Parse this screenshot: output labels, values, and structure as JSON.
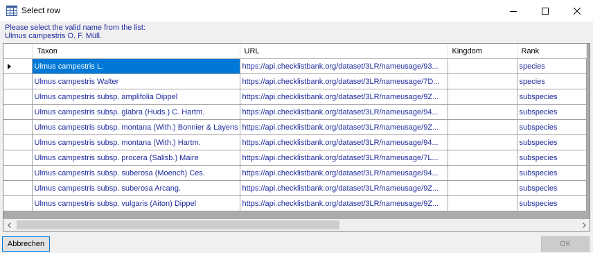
{
  "window": {
    "title": "Select row",
    "icon": "table-grid-icon"
  },
  "prompt": {
    "line1": "Please select the valid name from the list:",
    "line2": "Ulmus campestris O. F. Müll."
  },
  "grid": {
    "columns": [
      "Taxon",
      "URL",
      "Kingdom",
      "Rank"
    ],
    "rows": [
      {
        "taxon": "Ulmus campestris L.",
        "url": "https://api.checklistbank.org/dataset/3LR/nameusage/93...",
        "kingdom": "",
        "rank": "species"
      },
      {
        "taxon": "Ulmus campestris Walter",
        "url": "https://api.checklistbank.org/dataset/3LR/nameusage/7D...",
        "kingdom": "",
        "rank": "species"
      },
      {
        "taxon": "Ulmus campestris subsp. amplifolia Dippel",
        "url": "https://api.checklistbank.org/dataset/3LR/nameusage/9Z...",
        "kingdom": "",
        "rank": "subspecies"
      },
      {
        "taxon": "Ulmus campestris subsp. glabra (Huds.) C. Hartm.",
        "url": "https://api.checklistbank.org/dataset/3LR/nameusage/94...",
        "kingdom": "",
        "rank": "subspecies"
      },
      {
        "taxon": "Ulmus campestris subsp. montana (With.) Bonnier & Layens",
        "url": "https://api.checklistbank.org/dataset/3LR/nameusage/9Z...",
        "kingdom": "",
        "rank": "subspecies"
      },
      {
        "taxon": "Ulmus campestris subsp. montana (With.) Hartm.",
        "url": "https://api.checklistbank.org/dataset/3LR/nameusage/94...",
        "kingdom": "",
        "rank": "subspecies"
      },
      {
        "taxon": "Ulmus campestris subsp. procera (Salisb.) Maire",
        "url": "https://api.checklistbank.org/dataset/3LR/nameusage/7L...",
        "kingdom": "",
        "rank": "subspecies"
      },
      {
        "taxon": "Ulmus campestris subsp. suberosa (Moench) Ces.",
        "url": "https://api.checklistbank.org/dataset/3LR/nameusage/94...",
        "kingdom": "",
        "rank": "subspecies"
      },
      {
        "taxon": "Ulmus campestris subsp. suberosa Arcang.",
        "url": "https://api.checklistbank.org/dataset/3LR/nameusage/9Z...",
        "kingdom": "",
        "rank": "subspecies"
      },
      {
        "taxon": "Ulmus campestris subsp. vulgaris (Aiton) Dippel",
        "url": "https://api.checklistbank.org/dataset/3LR/nameusage/9Z...",
        "kingdom": "",
        "rank": "subspecies"
      }
    ],
    "selected_row": 0
  },
  "buttons": {
    "cancel": "Abbrechen",
    "ok": "OK"
  },
  "colors": {
    "text_blue": "#1e2a9e",
    "selection": "#0078d7"
  }
}
